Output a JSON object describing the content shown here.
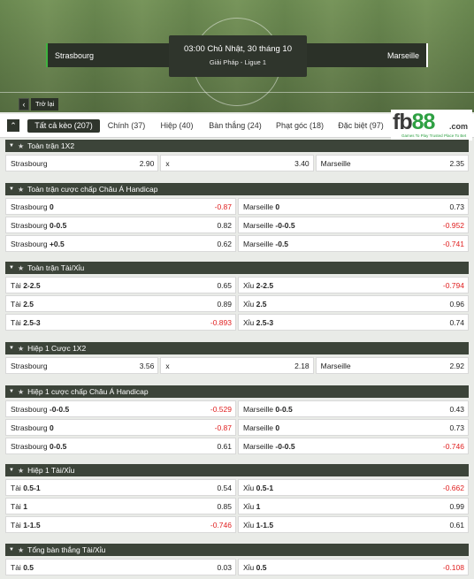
{
  "match": {
    "home": "Strasbourg",
    "away": "Marseille",
    "time": "03:00 Chủ Nhật, 30 tháng 10",
    "league": "Giải Pháp - Ligue 1",
    "back_label": "Trở lại"
  },
  "tabs": [
    {
      "label": "Tất cả kèo (207)",
      "active": true
    },
    {
      "label": "Chính (37)"
    },
    {
      "label": "Hiệp (40)"
    },
    {
      "label": "Bàn thắng (24)"
    },
    {
      "label": "Phạt góc (18)"
    },
    {
      "label": "Đặc biệt (97)"
    }
  ],
  "logo": {
    "text_a": "fb",
    "text_b": "88",
    "text_c": ".com",
    "tagline": "Games To Play   Trusted Place To Bet"
  },
  "colors": {
    "negative": "#e02020",
    "header_bg": "#3c4439",
    "active_tab": "#2f352c",
    "accent": "#2ea043"
  },
  "sections": [
    {
      "title": "Toàn trận 1X2",
      "rows": [
        [
          {
            "name": "Strasbourg",
            "line": "",
            "odd": "2.90"
          },
          {
            "name": "x",
            "line": "",
            "odd": "3.40"
          },
          {
            "name": "Marseille",
            "line": "",
            "odd": "2.35"
          }
        ]
      ]
    },
    {
      "title": "Toàn trận cược chấp Châu Á Handicap",
      "rows": [
        [
          {
            "name": "Strasbourg",
            "line": "0",
            "odd": "-0.87"
          },
          {
            "name": "Marseille",
            "line": "0",
            "odd": "0.73"
          }
        ],
        [
          {
            "name": "Strasbourg",
            "line": "0-0.5",
            "odd": "0.82"
          },
          {
            "name": "Marseille",
            "line": "-0-0.5",
            "odd": "-0.952"
          }
        ],
        [
          {
            "name": "Strasbourg",
            "line": "+0.5",
            "odd": "0.62"
          },
          {
            "name": "Marseille",
            "line": "-0.5",
            "odd": "-0.741"
          }
        ]
      ]
    },
    {
      "title": "Toàn trận Tài/Xỉu",
      "rows": [
        [
          {
            "name": "Tài",
            "line": "2-2.5",
            "odd": "0.65"
          },
          {
            "name": "Xỉu",
            "line": "2-2.5",
            "odd": "-0.794"
          }
        ],
        [
          {
            "name": "Tài",
            "line": "2.5",
            "odd": "0.89"
          },
          {
            "name": "Xỉu",
            "line": "2.5",
            "odd": "0.96"
          }
        ],
        [
          {
            "name": "Tài",
            "line": "2.5-3",
            "odd": "-0.893"
          },
          {
            "name": "Xỉu",
            "line": "2.5-3",
            "odd": "0.74"
          }
        ]
      ]
    },
    {
      "title": "Hiệp 1 Cược 1X2",
      "rows": [
        [
          {
            "name": "Strasbourg",
            "line": "",
            "odd": "3.56"
          },
          {
            "name": "x",
            "line": "",
            "odd": "2.18"
          },
          {
            "name": "Marseille",
            "line": "",
            "odd": "2.92"
          }
        ]
      ]
    },
    {
      "title": "Hiệp 1 cược chấp Châu Á Handicap",
      "rows": [
        [
          {
            "name": "Strasbourg",
            "line": "-0-0.5",
            "odd": "-0.529"
          },
          {
            "name": "Marseille",
            "line": "0-0.5",
            "odd": "0.43"
          }
        ],
        [
          {
            "name": "Strasbourg",
            "line": "0",
            "odd": "-0.87"
          },
          {
            "name": "Marseille",
            "line": "0",
            "odd": "0.73"
          }
        ],
        [
          {
            "name": "Strasbourg",
            "line": "0-0.5",
            "odd": "0.61"
          },
          {
            "name": "Marseille",
            "line": "-0-0.5",
            "odd": "-0.746"
          }
        ]
      ]
    },
    {
      "title": "Hiệp 1 Tài/Xỉu",
      "rows": [
        [
          {
            "name": "Tài",
            "line": "0.5-1",
            "odd": "0.54"
          },
          {
            "name": "Xỉu",
            "line": "0.5-1",
            "odd": "-0.662"
          }
        ],
        [
          {
            "name": "Tài",
            "line": "1",
            "odd": "0.85"
          },
          {
            "name": "Xỉu",
            "line": "1",
            "odd": "0.99"
          }
        ],
        [
          {
            "name": "Tài",
            "line": "1-1.5",
            "odd": "-0.746"
          },
          {
            "name": "Xỉu",
            "line": "1-1.5",
            "odd": "0.61"
          }
        ]
      ]
    },
    {
      "title": "Tổng bàn thắng Tài/Xỉu",
      "rows": [
        [
          {
            "name": "Tài",
            "line": "0.5",
            "odd": "0.03"
          },
          {
            "name": "Xỉu",
            "line": "0.5",
            "odd": "-0.108"
          }
        ]
      ]
    }
  ]
}
